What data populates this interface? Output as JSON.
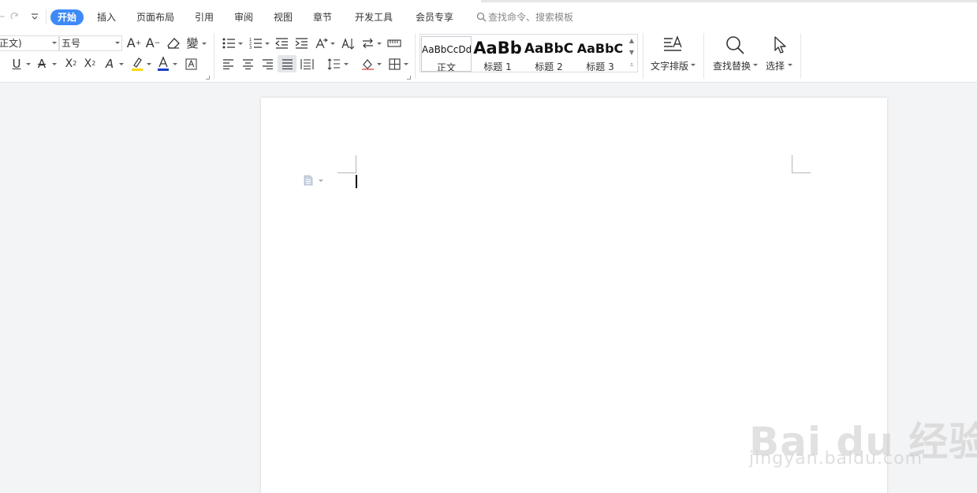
{
  "quick_access": {
    "undo_icon": "undo-icon",
    "redo_icon": "redo-icon",
    "more_icon": "chevron-down-icon"
  },
  "menu_tabs": [
    "开始",
    "插入",
    "页面布局",
    "引用",
    "审阅",
    "视图",
    "章节",
    "开发工具",
    "会员专享"
  ],
  "search": {
    "placeholder": "查找命令、搜索模板"
  },
  "font": {
    "name": "正文)",
    "size": "五号"
  },
  "styles": [
    {
      "preview": "AaBbCcDd",
      "label": "正文"
    },
    {
      "preview": "AaBb",
      "label": "标题 1"
    },
    {
      "preview": "AaBbC",
      "label": "标题 2"
    },
    {
      "preview": "AaBbC",
      "label": "标题 3"
    }
  ],
  "big_buttons": {
    "text_layout": "文字排版",
    "find_replace": "查找替换",
    "select": "选择"
  },
  "watermark": {
    "brand": "Bai du 经验",
    "url": "jingyan.baidu.com"
  },
  "colors": {
    "accent": "#3d8af7",
    "highlight": "#ffd800",
    "font_color": "#1b3ec6"
  }
}
